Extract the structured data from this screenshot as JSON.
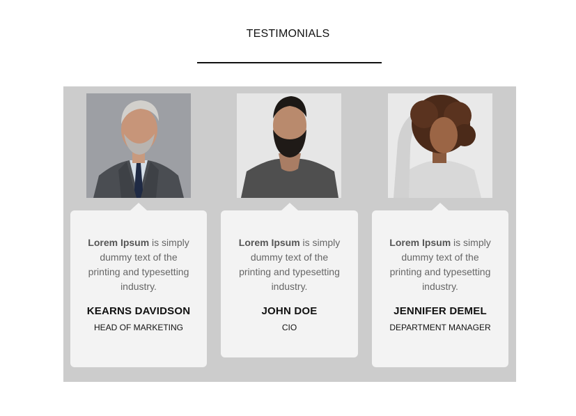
{
  "header": {
    "title": "TESTIMONIALS"
  },
  "testimonials": [
    {
      "quote_strong": "Lorem Ipsum",
      "quote_rest": " is simply dummy text of the printing and typesetting industry.",
      "name": "KEARNS DAVIDSON",
      "role": "HEAD OF MARKETING"
    },
    {
      "quote_strong": "Lorem Ipsum",
      "quote_rest": " is simply dummy text of the printing and typesetting industry.",
      "name": "JOHN DOE",
      "role": "CIO"
    },
    {
      "quote_strong": "Lorem Ipsum",
      "quote_rest": " is simply dummy text of the printing and typesetting industry.",
      "name": "JENNIFER DEMEL",
      "role": "DEPARTMENT MANAGER"
    }
  ],
  "colors": {
    "panel_background": "#cccccc",
    "card_background": "#f3f3f3",
    "heading_text": "#111111",
    "quote_text": "#666666"
  }
}
